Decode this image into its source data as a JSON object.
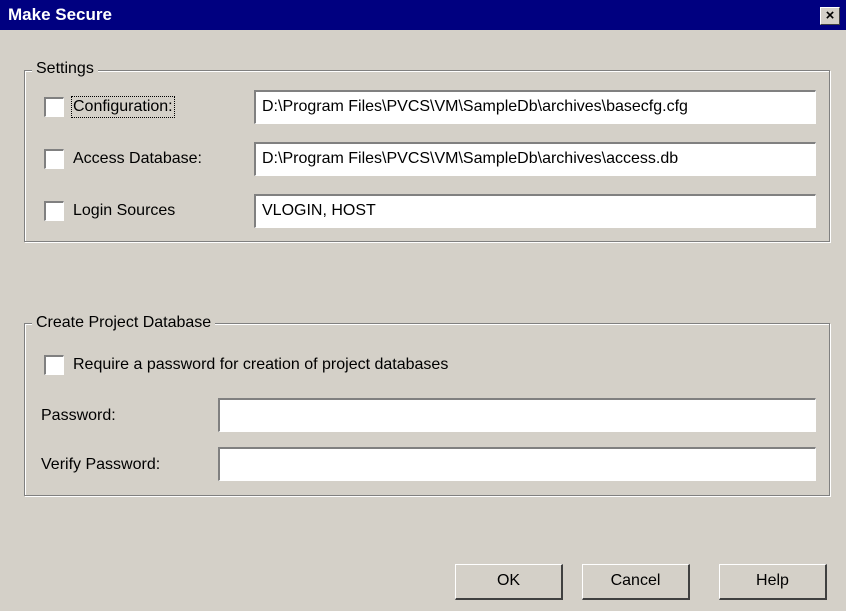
{
  "window": {
    "title": "Make Secure",
    "close_glyph": "×"
  },
  "settings": {
    "legend": "Settings",
    "rows": [
      {
        "label": "Configuration:",
        "value": "D:\\Program Files\\PVCS\\VM\\SampleDb\\archives\\basecfg.cfg",
        "checked": false
      },
      {
        "label": "Access Database:",
        "value": "D:\\Program Files\\PVCS\\VM\\SampleDb\\archives\\access.db",
        "checked": false
      },
      {
        "label": "Login Sources",
        "value": "VLOGIN, HOST",
        "checked": false
      }
    ]
  },
  "project": {
    "legend": "Create Project Database",
    "require_label": "Require a password for creation of project databases",
    "require_checked": false,
    "password_label": "Password:",
    "password_value": "",
    "verify_label": "Verify Password:",
    "verify_value": ""
  },
  "buttons": {
    "ok": "OK",
    "cancel": "Cancel",
    "help": "Help"
  },
  "colors": {
    "titlebar": "#000080",
    "face": "#d4d0c8"
  }
}
